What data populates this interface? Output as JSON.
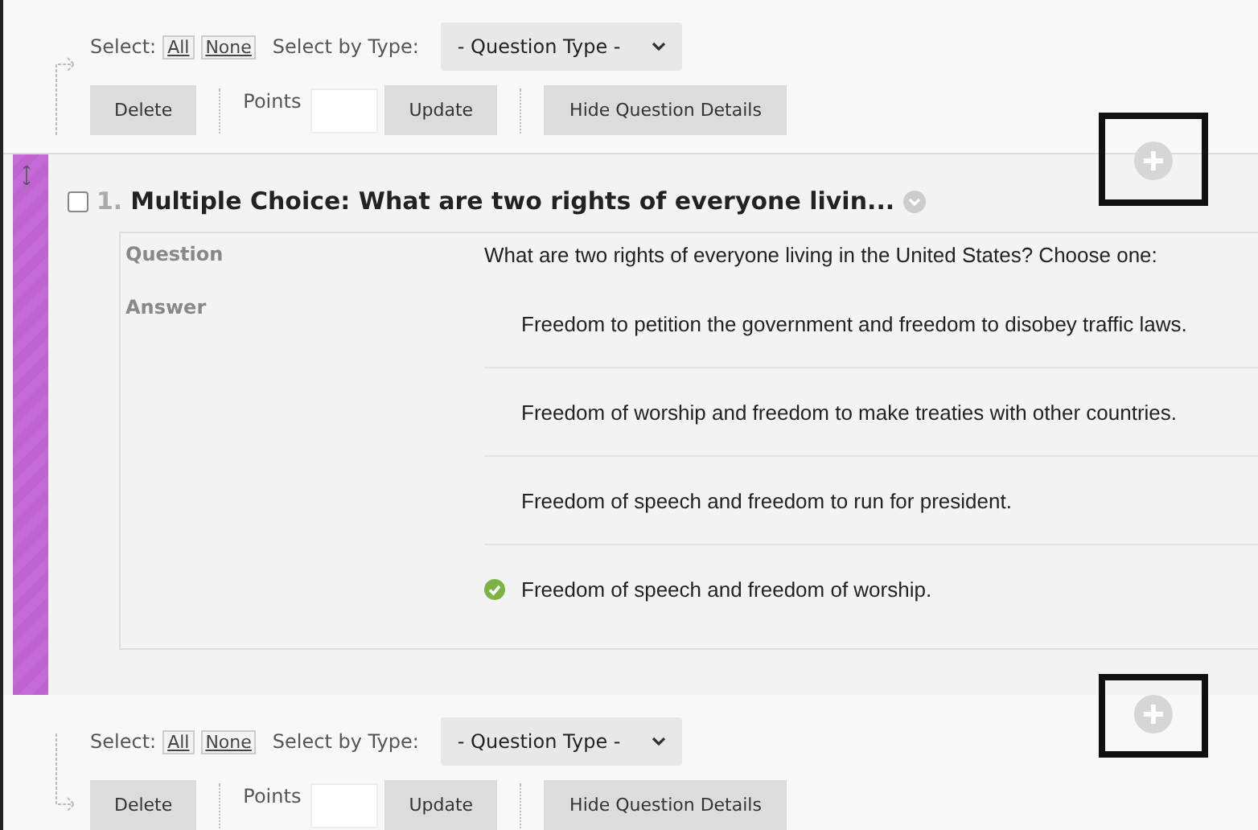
{
  "toolbars": [
    {
      "select_label": "Select:",
      "all": "All",
      "none": "None",
      "type_label": "Select by Type:",
      "type_value": "- Question Type -",
      "delete": "Delete",
      "points_label": "Points",
      "update": "Update",
      "details": "Hide Question Details"
    },
    {
      "select_label": "Select:",
      "all": "All",
      "none": "None",
      "type_label": "Select by Type:",
      "type_value": "- Question Type -",
      "delete": "Delete",
      "points_label": "Points",
      "update": "Update",
      "details": "Hide Question Details"
    }
  ],
  "question": {
    "checked": false,
    "number": "1.",
    "title": "Multiple Choice: What are two rights of everyone livin...",
    "question_label": "Question",
    "question_text": "What are two rights of everyone living in the United States? Choose one:",
    "answer_label": "Answer",
    "answers": [
      {
        "text": "Freedom to petition the government and freedom to disobey traffic laws.",
        "correct": false
      },
      {
        "text": "Freedom of worship and freedom to make treaties with other countries.",
        "correct": false
      },
      {
        "text": "Freedom of speech and freedom to run for president.",
        "correct": false
      },
      {
        "text": "Freedom of speech and freedom of worship.",
        "correct": true
      }
    ]
  }
}
